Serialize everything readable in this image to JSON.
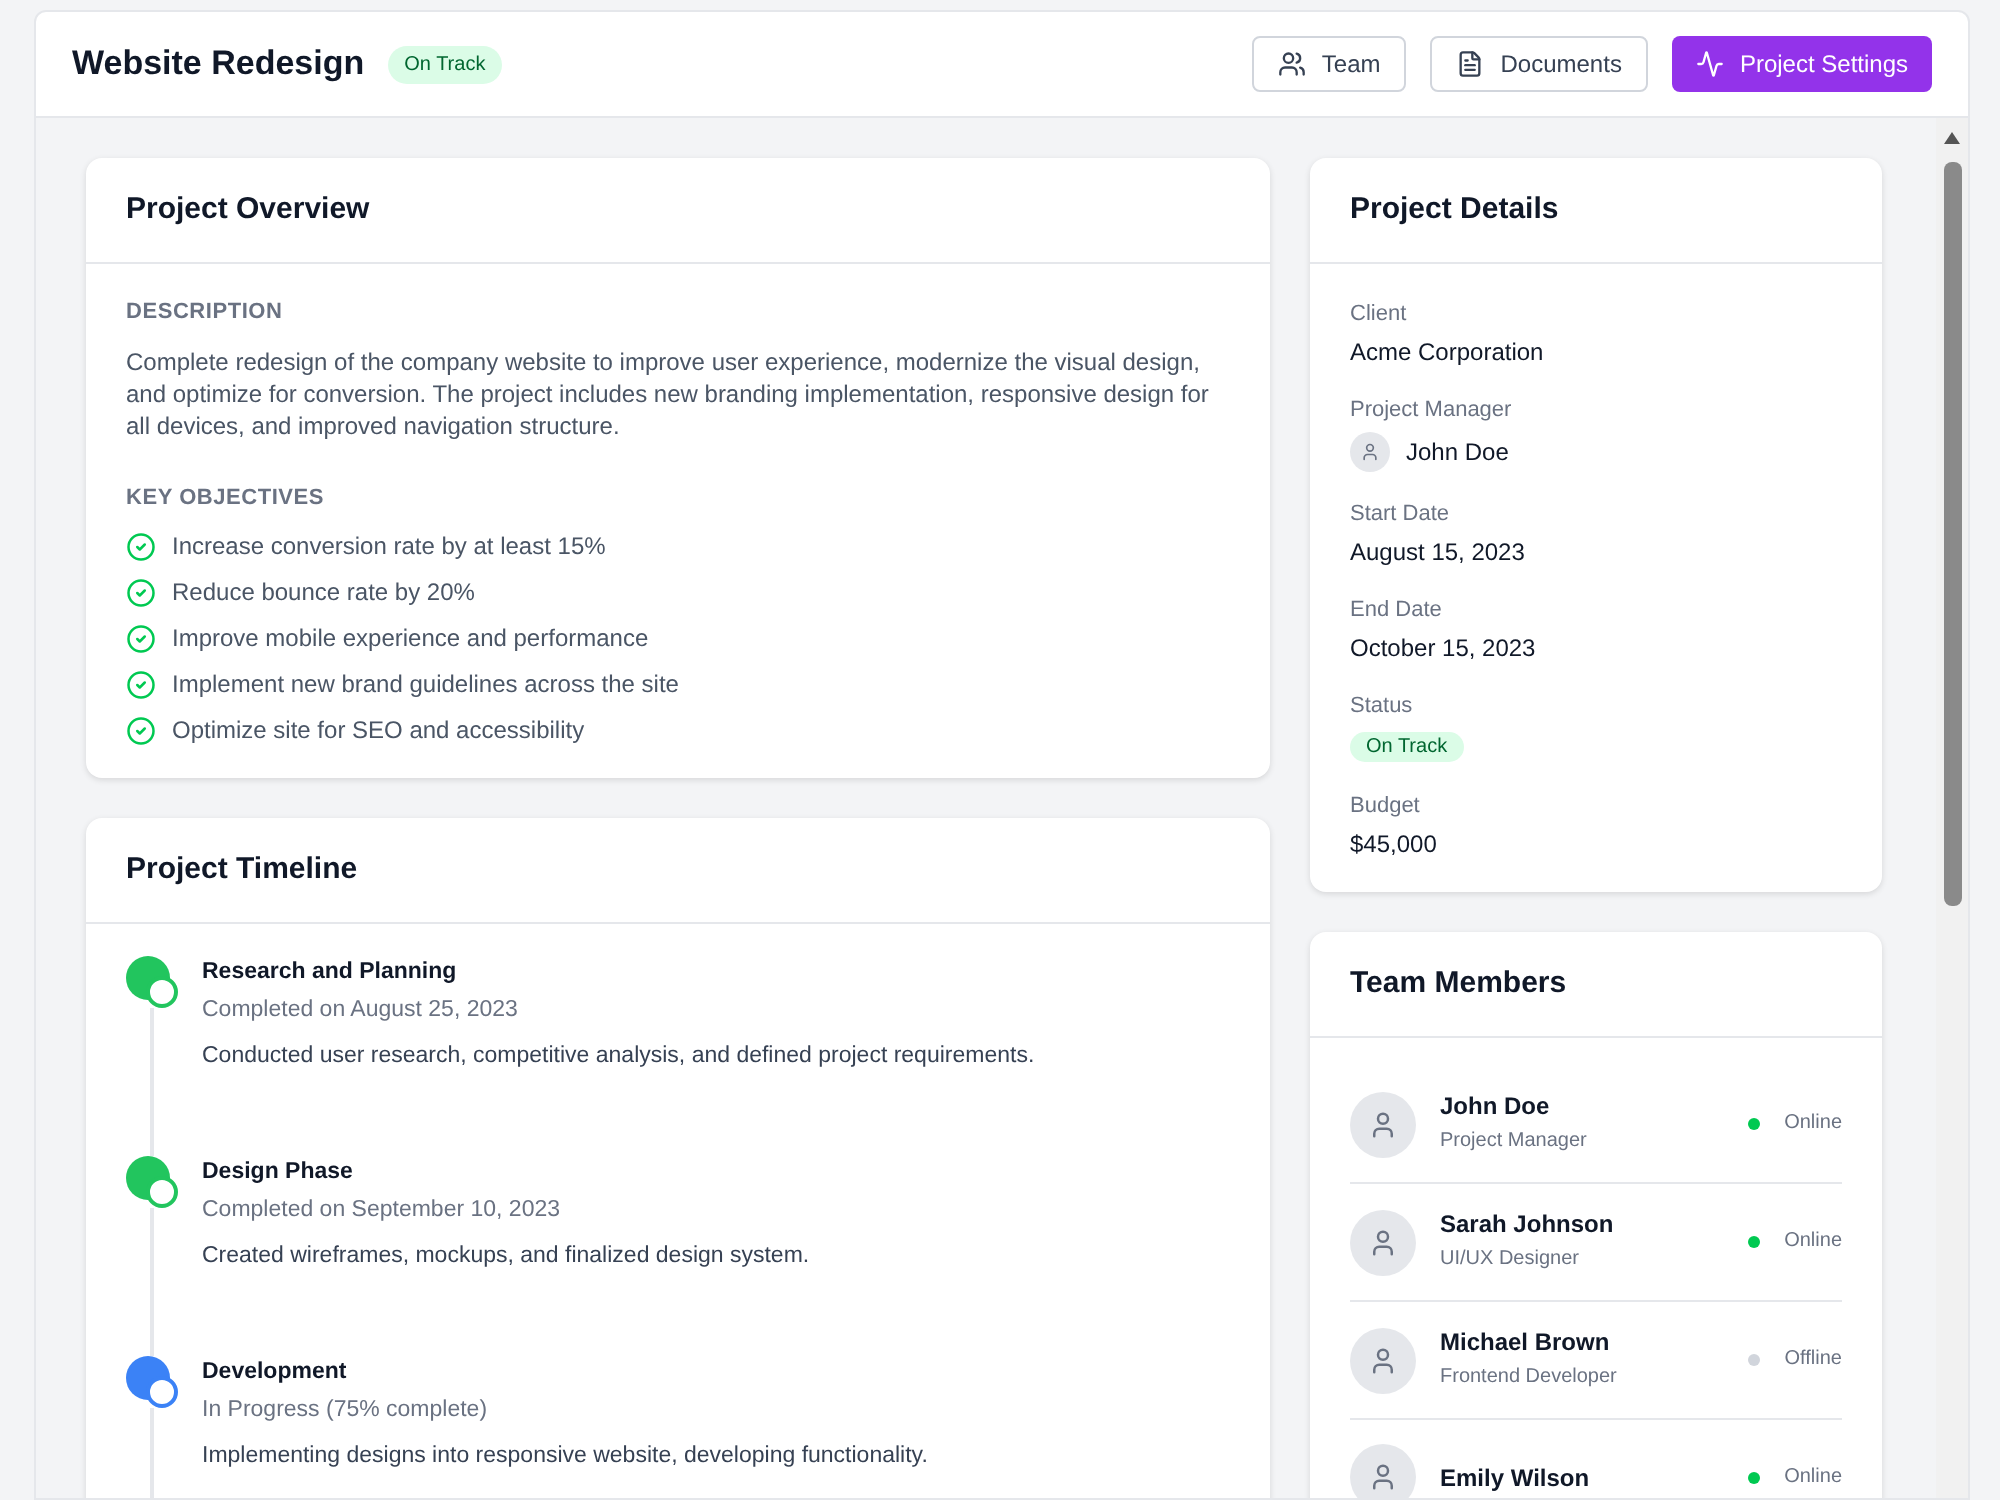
{
  "header": {
    "title": "Website Redesign",
    "badge": "On Track",
    "buttons": [
      {
        "kind": "team",
        "label": "Team",
        "primary": false
      },
      {
        "kind": "documents",
        "label": "Documents",
        "primary": false
      },
      {
        "kind": "settings",
        "label": "Project Settings",
        "primary": true
      }
    ]
  },
  "overview": {
    "title": "Project Overview",
    "description_label": "DESCRIPTION",
    "description": "Complete redesign of the company website to improve user experience, modernize the visual design, and optimize for conversion. The project includes new branding implementation, responsive design for all devices, and improved navigation structure.",
    "objectives_label": "KEY OBJECTIVES",
    "objectives": [
      "Increase conversion rate by at least 15%",
      "Reduce bounce rate by 20%",
      "Improve mobile experience and performance",
      "Implement new brand guidelines across the site",
      "Optimize site for SEO and accessibility"
    ]
  },
  "timeline": {
    "title": "Project Timeline",
    "items": [
      {
        "kind": "completed",
        "title": "Research and Planning",
        "status": "Completed on August 25, 2023",
        "text": "Conducted user research, competitive analysis, and defined project requirements."
      },
      {
        "kind": "completed",
        "title": "Design Phase",
        "status": "Completed on September 10, 2023",
        "text": "Created wireframes, mockups, and finalized design system."
      },
      {
        "kind": "in_progress",
        "title": "Development",
        "status": "In Progress (75% complete)",
        "text": "Implementing designs into responsive website, developing functionality."
      }
    ]
  },
  "details": {
    "title": "Project Details",
    "fields": [
      {
        "kind": "text",
        "label": "Client",
        "value": "Acme Corporation"
      },
      {
        "kind": "person",
        "label": "Project Manager",
        "value": "John Doe"
      },
      {
        "kind": "text",
        "label": "Start Date",
        "value": "August 15, 2023"
      },
      {
        "kind": "text",
        "label": "End Date",
        "value": "October 15, 2023"
      },
      {
        "kind": "badge",
        "label": "Status",
        "value": "On Track"
      },
      {
        "kind": "text",
        "label": "Budget",
        "value": "$45,000"
      }
    ]
  },
  "team": {
    "title": "Team Members",
    "members": [
      {
        "name": "John Doe",
        "role": "Project Manager",
        "online": true,
        "status": "Online"
      },
      {
        "name": "Sarah Johnson",
        "role": "UI/UX Designer",
        "online": true,
        "status": "Online"
      },
      {
        "name": "Michael Brown",
        "role": "Frontend Developer",
        "online": false,
        "status": "Offline"
      },
      {
        "name": "Emily Wilson",
        "online": true,
        "status": "Online"
      }
    ]
  }
}
